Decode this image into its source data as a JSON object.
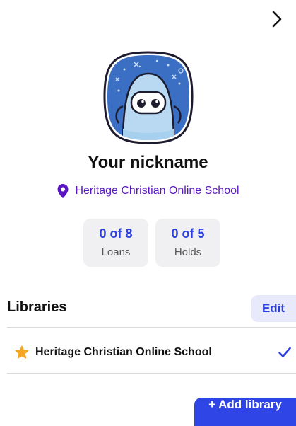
{
  "header": {
    "next_icon": "chevron-right-icon"
  },
  "profile": {
    "avatar_icon": "robot-avatar-icon",
    "nickname": "Your nickname",
    "library_icon": "location-pin-icon",
    "library_name": "Heritage Christian Online School",
    "accent": "#5a16c2"
  },
  "stats": [
    {
      "value": "0 of 8",
      "label": "Loans"
    },
    {
      "value": "0 of 5",
      "label": "Holds"
    }
  ],
  "libraries": {
    "heading": "Libraries",
    "edit_label": "Edit",
    "items": [
      {
        "name": "Heritage Christian Online School",
        "icon": "star-icon",
        "selected": true,
        "check_icon": "checkmark-icon"
      }
    ],
    "add_label": "+ Add library"
  },
  "colors": {
    "primary": "#2b3fe0",
    "star": "#f5a623"
  }
}
